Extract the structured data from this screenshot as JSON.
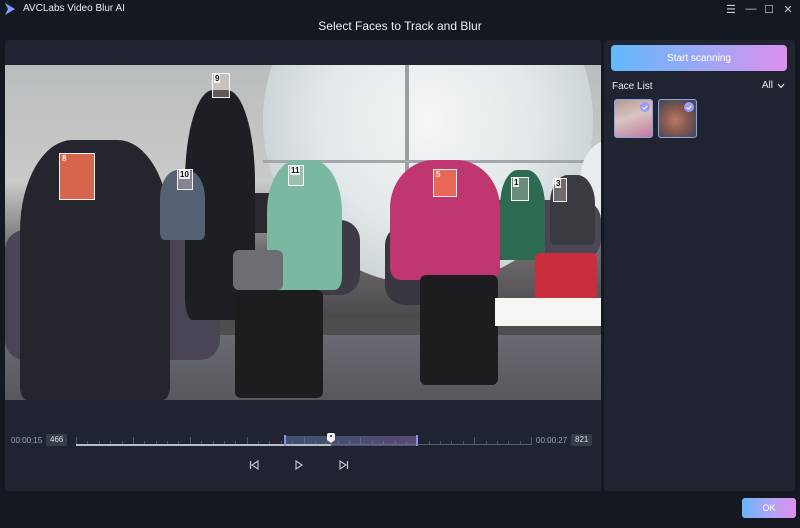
{
  "app": {
    "title": "AVCLabs Video Blur AI",
    "logo_icon": "play-triangle-logo-icon",
    "window_controls": [
      {
        "name": "menu",
        "icon": "hamburger-icon",
        "glyph": "☰"
      },
      {
        "name": "minimize",
        "icon": "minimize-icon",
        "glyph": "—"
      },
      {
        "name": "maximize",
        "icon": "maximize-icon",
        "glyph": "☐"
      },
      {
        "name": "close",
        "icon": "close-icon",
        "glyph": "✕"
      }
    ]
  },
  "page": {
    "title": "Select Faces to Track and Blur"
  },
  "video": {
    "faces": [
      {
        "id": "8",
        "selected": true
      },
      {
        "id": "9",
        "selected": false
      },
      {
        "id": "10",
        "selected": false
      },
      {
        "id": "11",
        "selected": false
      },
      {
        "id": "5",
        "selected": true
      },
      {
        "id": "1",
        "selected": false
      },
      {
        "id": "3",
        "selected": false
      }
    ]
  },
  "timeline": {
    "start_time": "00:00:15",
    "start_frame": "466",
    "end_time": "00:00:27",
    "end_frame": "821",
    "playhead_fraction": 0.56,
    "range_start_fraction": 0.46,
    "range_end_fraction": 0.75
  },
  "controls": {
    "prev_icon": "skip-to-start-icon",
    "play_icon": "play-icon",
    "next_icon": "skip-to-end-icon"
  },
  "sidebar": {
    "scan_button": "Start scanning",
    "face_list_label": "Face List",
    "filter_value": "All",
    "thumbnails": [
      {
        "name": "face-thumbnail-1",
        "checked": true
      },
      {
        "name": "face-thumbnail-2",
        "checked": true
      }
    ]
  },
  "footer": {
    "ok_label": "OK"
  },
  "colors": {
    "accent_gradient_start": "#64b8fb",
    "accent_gradient_end": "#dd90ee",
    "selected_face": "#ee6e52",
    "panel_bg": "#1f2430",
    "app_bg": "#131821"
  }
}
